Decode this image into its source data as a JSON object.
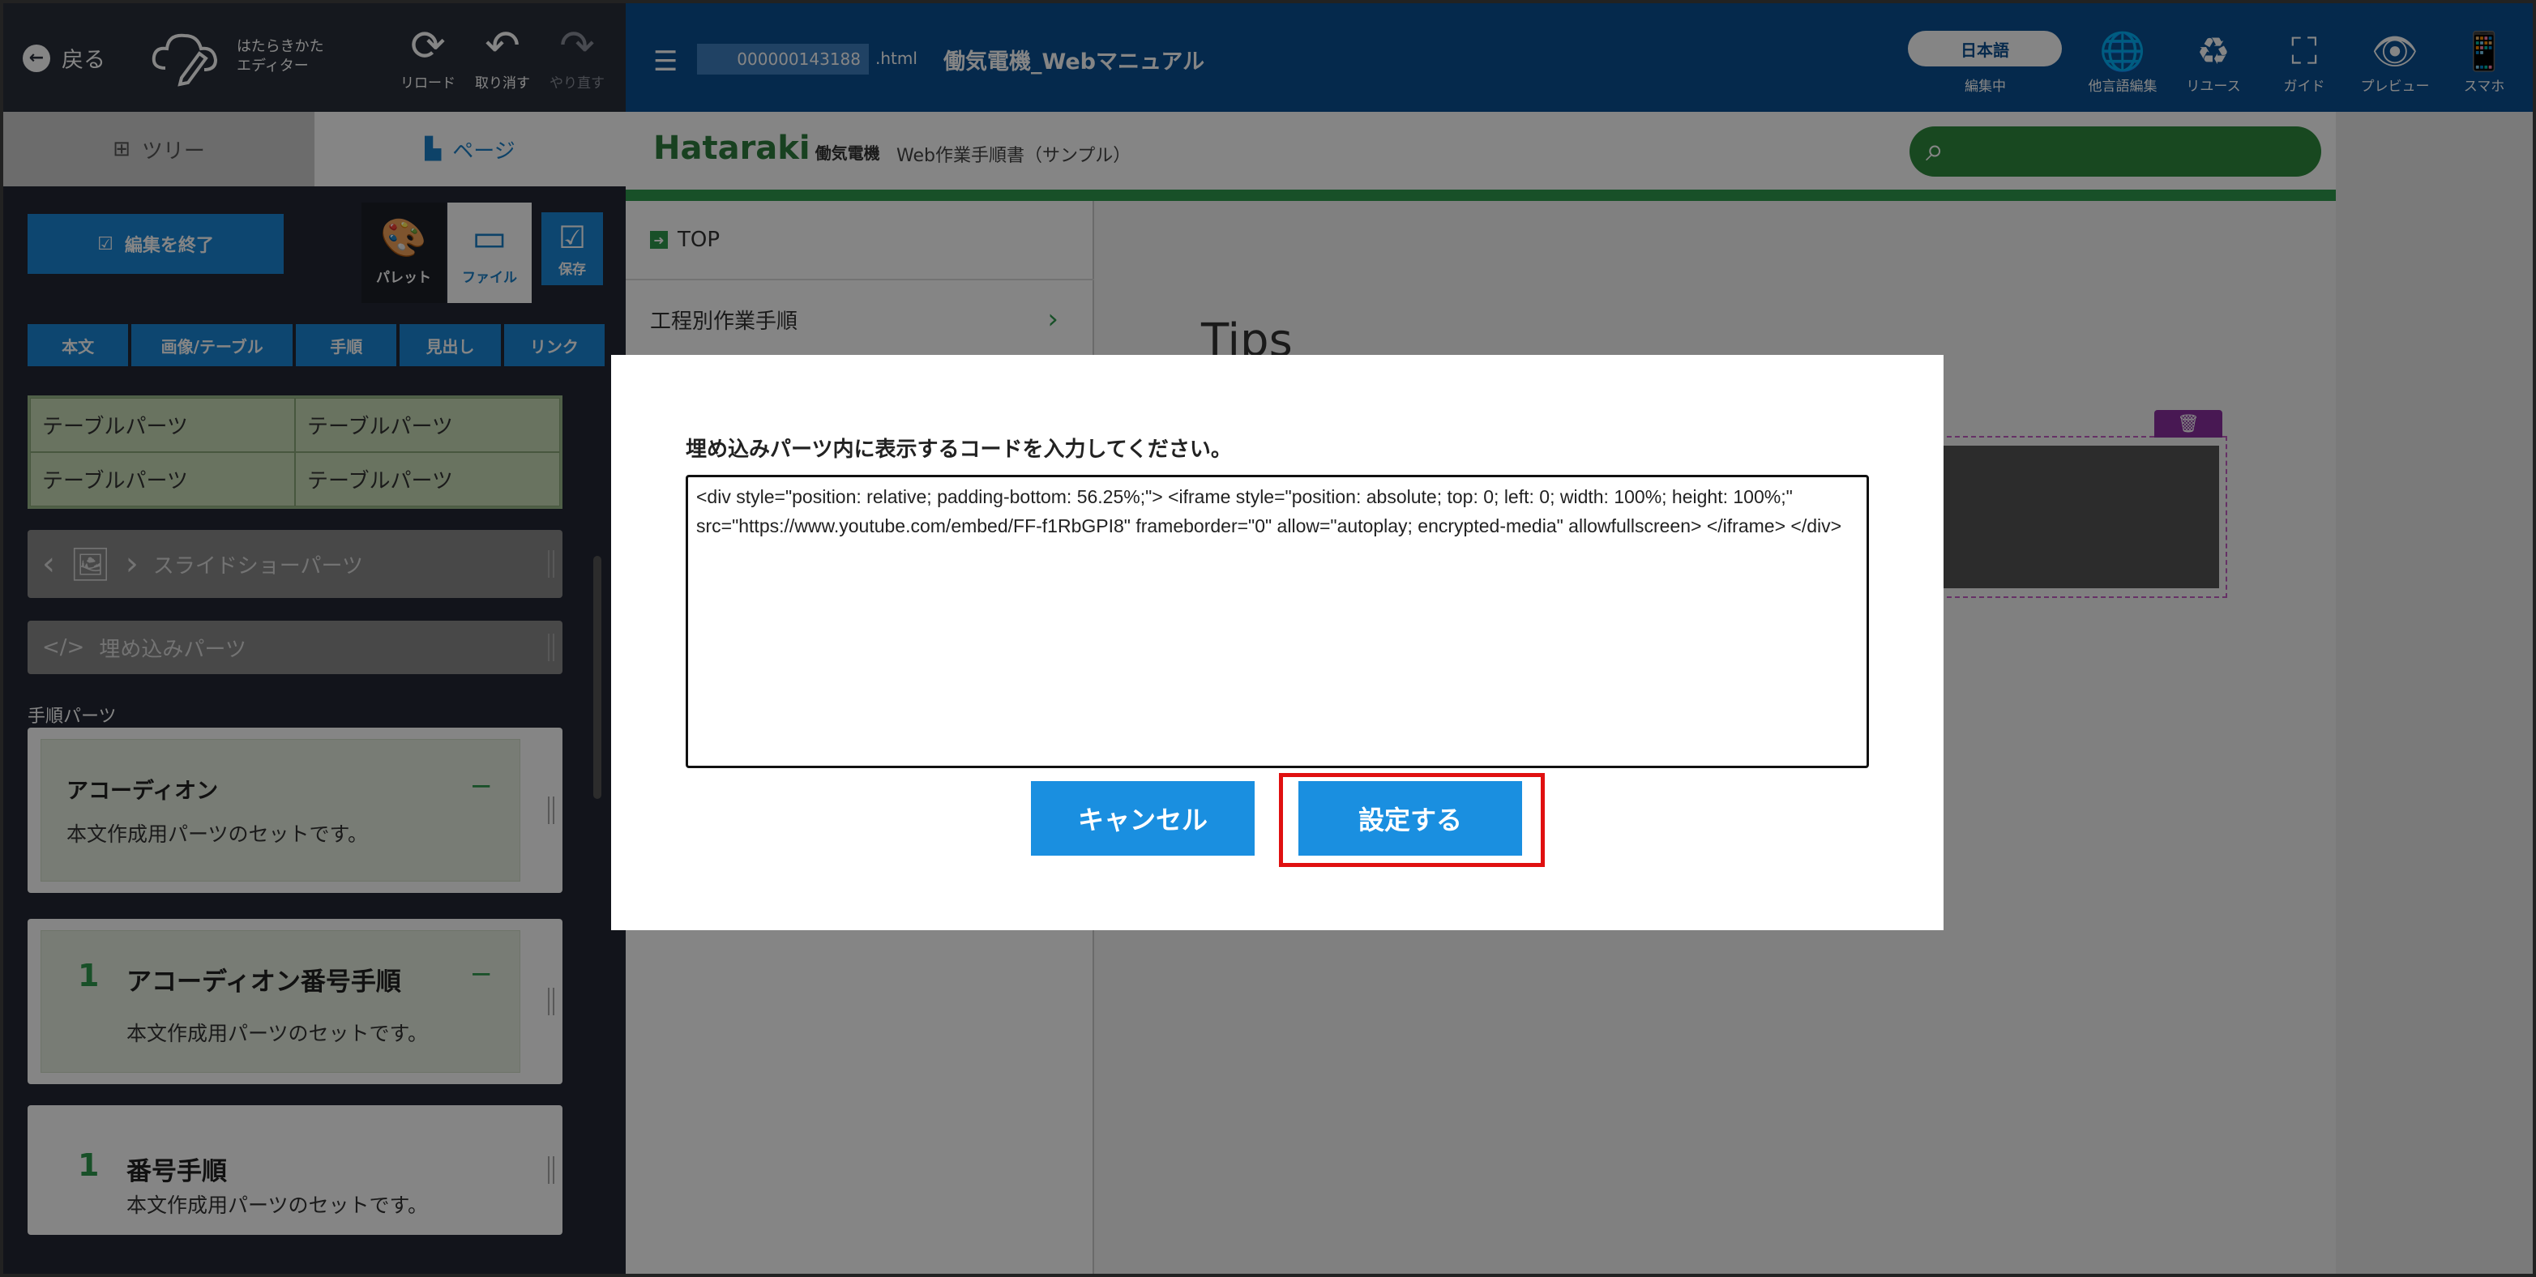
{
  "editor": {
    "back_label": "戻る",
    "logo_line1": "はたらきかた",
    "logo_line2": "エディター",
    "tools": [
      {
        "label": "リロード",
        "icon": "reload-icon",
        "glyph": "⟳"
      },
      {
        "label": "取り消す",
        "icon": "undo-icon",
        "glyph": "↶"
      },
      {
        "label": "やり直す",
        "icon": "redo-icon",
        "glyph": "↷"
      }
    ],
    "tab_tree": "ツリー",
    "tab_page": "ページ",
    "end_edit_label": "編集を終了",
    "palette_label": "パレット",
    "file_label": "ファイル",
    "save_label": "保存",
    "categories": [
      "本文",
      "画像/テーブル",
      "手順",
      "見出し",
      "リンク"
    ],
    "table_cells": [
      "テーブルパーツ",
      "テーブルパーツ",
      "テーブルパーツ",
      "テーブルパーツ"
    ],
    "slideshow_label": "スライドショーパーツ",
    "embed_label": "埋め込みパーツ",
    "step_section_label": "手順パーツ",
    "cards": [
      {
        "num": "",
        "title": "アコーディオン",
        "desc": "本文作成用パーツのセットです。"
      },
      {
        "num": "1",
        "title": "アコーディオン番号手順",
        "desc": "本文作成用パーツのセットです。"
      },
      {
        "num": "1",
        "title": "番号手順",
        "desc": "本文作成用パーツのセットです。"
      }
    ]
  },
  "header": {
    "file_id": "000000143188",
    "file_ext": ".html",
    "doc_title": "働気電機_Webマニュアル",
    "language": "日本語",
    "language_status": "編集中",
    "tools": [
      {
        "label": "他言語編集",
        "icon": "globe-monitor-icon",
        "glyph": "🌐"
      },
      {
        "label": "リユース",
        "icon": "recycle-icon",
        "glyph": "♻"
      },
      {
        "label": "ガイド",
        "icon": "guide-frame-icon",
        "glyph": "⛶"
      },
      {
        "label": "プレビュー",
        "icon": "eye-icon",
        "glyph": "👁"
      },
      {
        "label": "スマホ",
        "icon": "smartphone-icon",
        "glyph": "📱"
      }
    ]
  },
  "site": {
    "brand": "Hataraki",
    "brand_sub": "働気電機",
    "manual_name": "Web作業手順書（サンプル）",
    "nav": [
      {
        "label": "TOP"
      },
      {
        "label": "工程別作業手順"
      }
    ],
    "section_heading": "Tips"
  },
  "dialog": {
    "prompt": "埋め込みパーツ内に表示するコードを入力してください。",
    "code": "<div style=\"position: relative; padding-bottom: 56.25%;\"> <iframe style=\"position: absolute; top: 0; left: 0; width: 100%; height: 100%;\" src=\"https://www.youtube.com/embed/FF-f1RbGPI8\" frameborder=\"0\" allow=\"autoplay; encrypted-media\" allowfullscreen> </iframe> </div>",
    "cancel_label": "キャンセル",
    "confirm_label": "設定する"
  },
  "colors": {
    "header_blue": "#0b4f93",
    "button_blue": "#1a8fe0",
    "brand_green": "#2e9a4e",
    "highlight_red": "#e01010",
    "embed_purple": "#8a2ea0"
  }
}
